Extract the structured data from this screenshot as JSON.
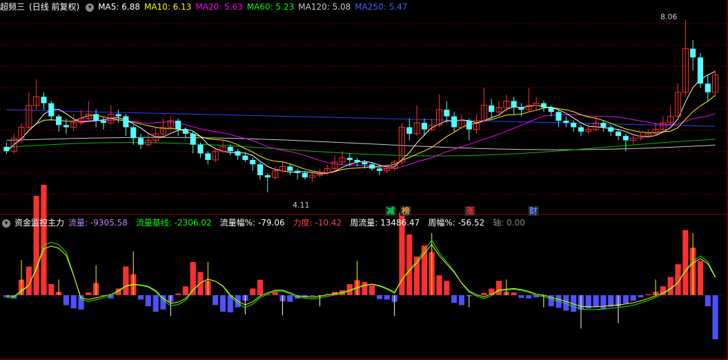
{
  "main_header": {
    "title": "超频三",
    "mode": "(日线 前复权)",
    "ma": [
      {
        "label": "MA5: 6.88",
        "color": "#ffffff"
      },
      {
        "label": "MA10: 6.13",
        "color": "#ffff00"
      },
      {
        "label": "MA20: 5.63",
        "color": "#ff00ff"
      },
      {
        "label": "MA60: 5.23",
        "color": "#00ff00"
      },
      {
        "label": "MA120: 5.08",
        "color": "#cccccc"
      },
      {
        "label": "MA250: 5.47",
        "color": "#4060ff"
      }
    ]
  },
  "annotations": {
    "high": "8.06",
    "low": "4.11"
  },
  "badges": [
    {
      "label": "减",
      "color": "#00e050"
    },
    {
      "label": "榜",
      "color": "#e0a040"
    },
    {
      "label": "涨",
      "color": "#ff3030"
    },
    {
      "label": "财",
      "color": "#6080ff"
    }
  ],
  "sub_header": {
    "title": "资金监控主力",
    "items": [
      {
        "name": "流量",
        "value": "-9305.58",
        "ncolor": "#c080ff",
        "vcolor": "#c080ff"
      },
      {
        "name": "流量基线",
        "value": "-2306.02",
        "ncolor": "#00ff00",
        "vcolor": "#00ff00"
      },
      {
        "name": "流量幅%",
        "value": "-79.06",
        "ncolor": "#ffffff",
        "vcolor": "#ffffff"
      },
      {
        "name": "力度",
        "value": "-10.42",
        "ncolor": "#ff4040",
        "vcolor": "#ff4040"
      },
      {
        "name": "周流量",
        "value": "13486.47",
        "ncolor": "#ffffff",
        "vcolor": "#ffffff"
      },
      {
        "name": "周幅%",
        "value": "-56.52",
        "ncolor": "#ffffff",
        "vcolor": "#ffffff"
      },
      {
        "name": "轴",
        "value": "0.00",
        "ncolor": "#888888",
        "vcolor": "#888888"
      }
    ]
  },
  "colors": {
    "up": "#ff3030",
    "down": "#54ffff",
    "grid": "#7a0000",
    "separator": "#a00000"
  },
  "chart_data": {
    "type": "candlestick",
    "price_range": [
      3.9,
      8.2
    ],
    "candles": [
      [
        5.15,
        5.05,
        5.25,
        4.98
      ],
      [
        5.05,
        5.35,
        5.45,
        5.0
      ],
      [
        5.35,
        5.6,
        5.7,
        5.25
      ],
      [
        5.6,
        6.1,
        6.4,
        5.5
      ],
      [
        6.1,
        6.3,
        6.7,
        6.0
      ],
      [
        6.3,
        6.15,
        6.4,
        6.0
      ],
      [
        6.15,
        5.85,
        6.2,
        5.75
      ],
      [
        5.85,
        5.65,
        5.9,
        5.5
      ],
      [
        5.65,
        5.6,
        5.8,
        5.45
      ],
      [
        5.6,
        5.7,
        5.9,
        5.5
      ],
      [
        5.7,
        5.8,
        6.0,
        5.65
      ],
      [
        5.8,
        5.9,
        6.2,
        5.75
      ],
      [
        5.9,
        5.75,
        6.0,
        5.6
      ],
      [
        5.75,
        5.7,
        5.85,
        5.55
      ],
      [
        5.7,
        5.9,
        6.1,
        5.65
      ],
      [
        5.9,
        5.85,
        6.0,
        5.7
      ],
      [
        5.85,
        5.6,
        5.9,
        5.4
      ],
      [
        5.6,
        5.35,
        5.65,
        5.2
      ],
      [
        5.35,
        5.2,
        5.45,
        5.1
      ],
      [
        5.2,
        5.3,
        5.45,
        5.15
      ],
      [
        5.3,
        5.45,
        5.6,
        5.25
      ],
      [
        5.45,
        5.6,
        5.8,
        5.4
      ],
      [
        5.6,
        5.75,
        5.85,
        5.5
      ],
      [
        5.75,
        5.55,
        5.8,
        5.4
      ],
      [
        5.55,
        5.45,
        5.6,
        5.35
      ],
      [
        5.45,
        5.2,
        5.5,
        5.0
      ],
      [
        5.2,
        5.0,
        5.25,
        4.9
      ],
      [
        5.0,
        4.85,
        5.05,
        4.75
      ],
      [
        4.85,
        5.05,
        5.1,
        4.8
      ],
      [
        5.05,
        5.15,
        5.3,
        5.0
      ],
      [
        5.15,
        5.05,
        5.2,
        4.95
      ],
      [
        5.05,
        4.95,
        5.1,
        4.85
      ],
      [
        4.95,
        4.85,
        5.0,
        4.8
      ],
      [
        4.85,
        4.75,
        4.9,
        4.6
      ],
      [
        4.75,
        4.5,
        4.8,
        4.4
      ],
      [
        4.5,
        4.45,
        4.55,
        4.11
      ],
      [
        4.45,
        4.6,
        4.7,
        4.4
      ],
      [
        4.6,
        4.7,
        4.8,
        4.55
      ],
      [
        4.7,
        4.6,
        4.75,
        4.5
      ],
      [
        4.6,
        4.55,
        4.65,
        4.4
      ],
      [
        4.55,
        4.45,
        4.6,
        4.4
      ],
      [
        4.45,
        4.5,
        4.55,
        4.35
      ],
      [
        4.5,
        4.55,
        4.65,
        4.45
      ],
      [
        4.55,
        4.65,
        4.75,
        4.5
      ],
      [
        4.65,
        4.8,
        4.95,
        4.6
      ],
      [
        4.8,
        4.9,
        5.05,
        4.75
      ],
      [
        4.9,
        4.85,
        5.0,
        4.7
      ],
      [
        4.85,
        4.8,
        4.9,
        4.7
      ],
      [
        4.8,
        4.75,
        4.85,
        4.65
      ],
      [
        4.75,
        4.65,
        4.8,
        4.6
      ],
      [
        4.65,
        4.6,
        4.7,
        4.5
      ],
      [
        4.6,
        4.65,
        4.75,
        4.55
      ],
      [
        4.65,
        4.8,
        4.85,
        4.6
      ],
      [
        4.8,
        5.6,
        5.7,
        4.75
      ],
      [
        5.6,
        5.45,
        5.8,
        5.3
      ],
      [
        5.45,
        5.7,
        6.1,
        5.4
      ],
      [
        5.7,
        5.55,
        5.8,
        5.4
      ],
      [
        5.55,
        5.65,
        5.8,
        5.5
      ],
      [
        5.65,
        6.0,
        6.35,
        5.6
      ],
      [
        6.0,
        5.85,
        6.2,
        5.7
      ],
      [
        5.85,
        5.6,
        5.95,
        5.5
      ],
      [
        5.6,
        5.75,
        5.9,
        5.55
      ],
      [
        5.75,
        5.55,
        5.8,
        5.3
      ],
      [
        5.55,
        5.75,
        5.9,
        5.45
      ],
      [
        5.75,
        6.1,
        6.5,
        5.7
      ],
      [
        6.1,
        5.95,
        6.25,
        5.8
      ],
      [
        5.95,
        6.05,
        6.2,
        5.85
      ],
      [
        6.05,
        6.2,
        6.35,
        5.95
      ],
      [
        6.2,
        6.05,
        6.3,
        5.9
      ],
      [
        6.05,
        6.0,
        6.15,
        5.85
      ],
      [
        6.0,
        6.1,
        6.5,
        5.95
      ],
      [
        6.1,
        6.15,
        6.3,
        6.0
      ],
      [
        6.15,
        6.05,
        6.2,
        5.95
      ],
      [
        6.05,
        5.95,
        6.1,
        5.85
      ],
      [
        5.95,
        5.75,
        6.0,
        5.6
      ],
      [
        5.75,
        5.7,
        5.85,
        5.6
      ],
      [
        5.7,
        5.6,
        5.75,
        5.5
      ],
      [
        5.6,
        5.5,
        5.65,
        5.4
      ],
      [
        5.5,
        5.55,
        5.7,
        5.45
      ],
      [
        5.55,
        5.7,
        5.85,
        5.5
      ],
      [
        5.7,
        5.6,
        5.75,
        5.5
      ],
      [
        5.6,
        5.5,
        5.65,
        5.4
      ],
      [
        5.5,
        5.4,
        5.55,
        5.3
      ],
      [
        5.4,
        5.3,
        5.45,
        5.05
      ],
      [
        5.3,
        5.35,
        5.45,
        5.2
      ],
      [
        5.35,
        5.4,
        5.5,
        5.3
      ],
      [
        5.4,
        5.45,
        5.55,
        5.35
      ],
      [
        5.45,
        5.55,
        5.7,
        5.4
      ],
      [
        5.55,
        5.7,
        5.85,
        5.5
      ],
      [
        5.7,
        5.85,
        6.1,
        5.65
      ],
      [
        5.85,
        6.4,
        6.6,
        5.8
      ],
      [
        6.4,
        7.4,
        8.06,
        6.3
      ],
      [
        7.4,
        7.2,
        7.6,
        6.9
      ],
      [
        7.2,
        6.6,
        7.3,
        6.5
      ],
      [
        6.6,
        6.4,
        6.8,
        6.2
      ],
      [
        6.4,
        6.8,
        6.9,
        6.3
      ]
    ],
    "flow": [
      -40,
      -60,
      280,
      520,
      1800,
      2000,
      200,
      60,
      -180,
      -240,
      -260,
      50,
      220,
      -10,
      -60,
      120,
      520,
      380,
      -80,
      -200,
      -300,
      -260,
      -120,
      30,
      160,
      600,
      420,
      260,
      -180,
      -300,
      -310,
      -220,
      -100,
      120,
      280,
      10,
      60,
      -110,
      -120,
      -60,
      -40,
      -20,
      -10,
      20,
      60,
      90,
      200,
      270,
      240,
      180,
      -70,
      -80,
      -120,
      1500,
      1100,
      700,
      900,
      780,
      360,
      260,
      -140,
      -180,
      -20,
      -10,
      40,
      120,
      260,
      60,
      50,
      -50,
      -60,
      -40,
      -20,
      -200,
      -230,
      -280,
      -300,
      -260,
      -240,
      -220,
      -250,
      -210,
      -200,
      -150,
      -100,
      -40,
      20,
      60,
      160,
      330,
      560,
      1180,
      860,
      620,
      -200,
      -800
    ],
    "series": [
      {
        "name": "流量"
      },
      {
        "name": "流量基线"
      }
    ]
  }
}
